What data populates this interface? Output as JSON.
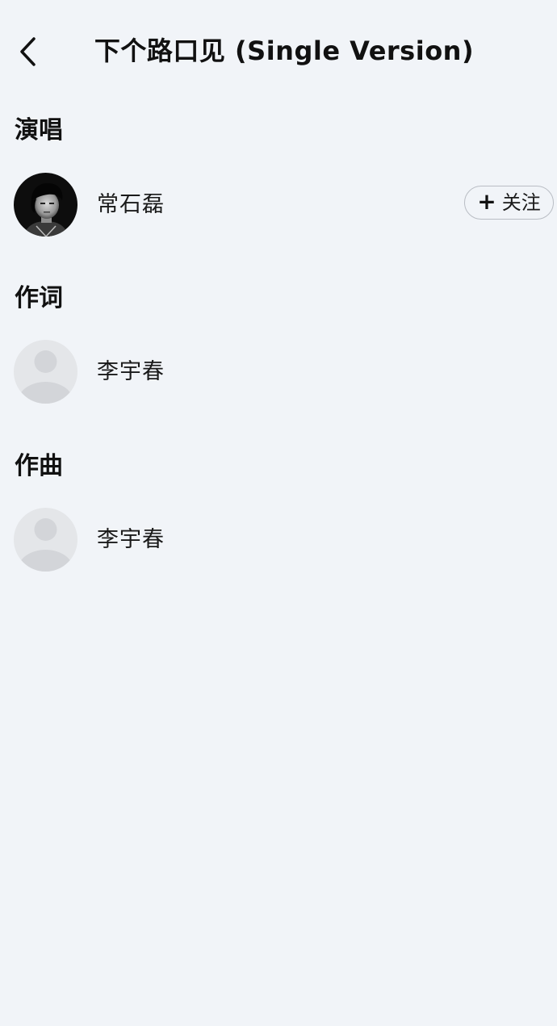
{
  "header": {
    "back_icon": "chevron-left-icon",
    "title": "下个路口见 (Single Version)"
  },
  "sections": [
    {
      "title": "演唱",
      "people": [
        {
          "name": "常石磊",
          "avatar": "photo",
          "follow_label": "关注",
          "follow_icon": "plus-icon"
        }
      ]
    },
    {
      "title": "作词",
      "people": [
        {
          "name": "李宇春",
          "avatar": "placeholder"
        }
      ]
    },
    {
      "title": "作曲",
      "people": [
        {
          "name": "李宇春",
          "avatar": "placeholder"
        }
      ]
    }
  ],
  "colors": {
    "background": "#f1f4f8",
    "text": "#111111",
    "placeholder_avatar": "#e4e6e9",
    "button_border": "#b9bdc4"
  }
}
